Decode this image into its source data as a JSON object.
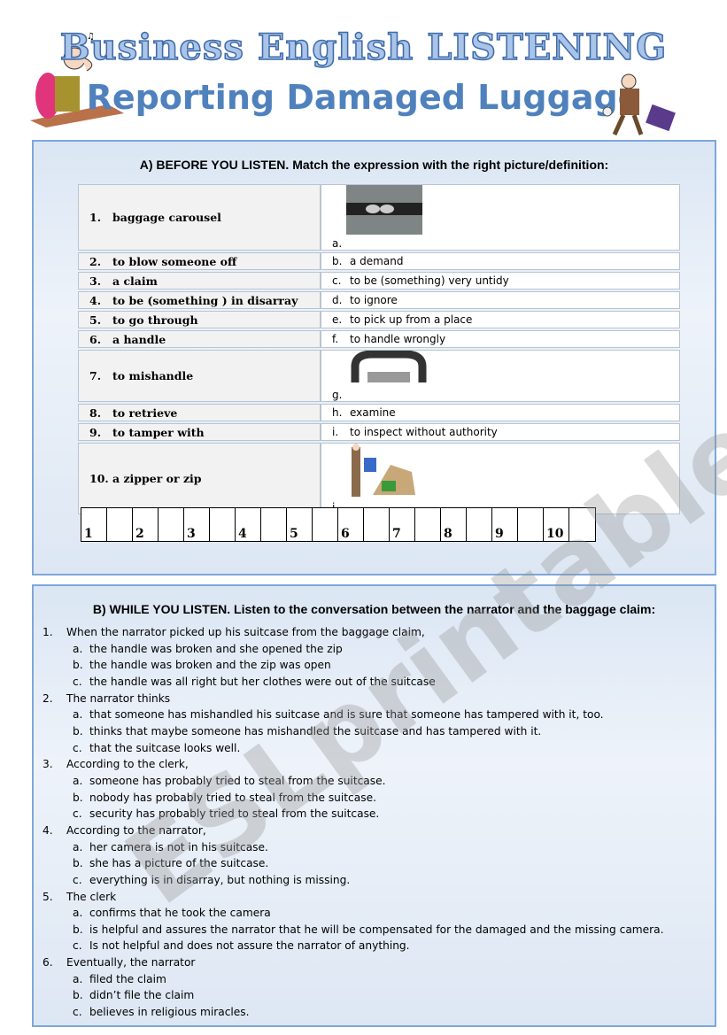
{
  "header": {
    "title": "Business English LISTENING",
    "subtitle": "Reporting Damaged Luggage"
  },
  "watermark": "ESLprintables.com",
  "section_a": {
    "title": "A) BEFORE YOU LISTEN. Match the expression with the right picture/definition:",
    "rows": [
      {
        "num": "1.",
        "term": "baggage carousel",
        "letter": "a.",
        "definition": "",
        "picture": "zipper-image"
      },
      {
        "num": "2.",
        "term": "to blow someone off",
        "letter": "b.",
        "definition": "a demand"
      },
      {
        "num": "3.",
        "term": "a claim",
        "letter": "c.",
        "definition": "to be (something) very untidy"
      },
      {
        "num": "4.",
        "term": "to be (something ) in disarray",
        "letter": "d.",
        "definition": "to ignore"
      },
      {
        "num": "5.",
        "term": "to go through",
        "letter": "e.",
        "definition": "to pick up from a place"
      },
      {
        "num": "6.",
        "term": "a handle",
        "letter": "f.",
        "definition": "to handle wrongly"
      },
      {
        "num": "7.",
        "term": "to mishandle",
        "letter": "g.",
        "definition": "",
        "picture": "handle-image"
      },
      {
        "num": "8.",
        "term": "to retrieve",
        "letter": "h.",
        "definition": "examine"
      },
      {
        "num": "9.",
        "term": "to tamper with",
        "letter": "i.",
        "definition": "to inspect without authority"
      },
      {
        "num": "10.",
        "term": "a zipper or zip",
        "letter": "i.",
        "definition": "",
        "picture": "carousel-image"
      }
    ],
    "answer_numbers": [
      "1",
      "2",
      "3",
      "4",
      "5",
      "6",
      "7",
      "8",
      "9",
      "10"
    ]
  },
  "section_b": {
    "title": "B) WHILE YOU LISTEN. Listen to the conversation between the narrator and the baggage claim:",
    "questions": [
      {
        "num": "1.",
        "text": "When the narrator picked up his suitcase from the baggage claim,",
        "options": [
          {
            "l": "a.",
            "t": "the handle was broken and she opened the zip"
          },
          {
            "l": "b.",
            "t": "the handle was broken and the zip was open"
          },
          {
            "l": "c.",
            "t": "the handle was all right but her clothes were out of the suitcase"
          }
        ]
      },
      {
        "num": "2.",
        "text": "The narrator thinks",
        "options": [
          {
            "l": "a.",
            "t": "that someone has mishandled his suitcase and is sure that someone has tampered with it, too."
          },
          {
            "l": "b.",
            "t": "thinks that maybe someone has mishandled the suitcase and has tampered with it."
          },
          {
            "l": "c.",
            "t": "that the suitcase looks well."
          }
        ]
      },
      {
        "num": "3.",
        "text": "According to the clerk,",
        "options": [
          {
            "l": "a.",
            "t": "someone has probably tried to steal from the suitcase."
          },
          {
            "l": "b.",
            "t": "nobody has probably tried to steal from the suitcase."
          },
          {
            "l": "c.",
            "t": "security has probably tried to steal from the suitcase."
          }
        ]
      },
      {
        "num": "4.",
        "text": "According to the narrator,",
        "options": [
          {
            "l": "a.",
            "t": "her camera is not in his suitcase."
          },
          {
            "l": "b.",
            "t": "she has a picture of the suitcase."
          },
          {
            "l": "c.",
            "t": "everything is in disarray, but nothing is missing."
          }
        ]
      },
      {
        "num": "5.",
        "text": "The clerk",
        "options": [
          {
            "l": "a.",
            "t": "confirms that he took the camera"
          },
          {
            "l": "b.",
            "t": "is helpful and assures the narrator that he will be compensated for the damaged and the missing camera."
          },
          {
            "l": "c.",
            "t": "Is not helpful and does not assure the narrator of anything."
          }
        ]
      },
      {
        "num": "6.",
        "text": "Eventually, the narrator",
        "options": [
          {
            "l": "a.",
            "t": "filed the claim"
          },
          {
            "l": "b.",
            "t": "didn’t file the claim"
          },
          {
            "l": "c.",
            "t": "believes in religious miracles."
          }
        ]
      }
    ]
  },
  "colors": {
    "title_blue": "#4f81bd",
    "box_border": "#7da7d9",
    "box_bg": "#e4ecf6"
  }
}
